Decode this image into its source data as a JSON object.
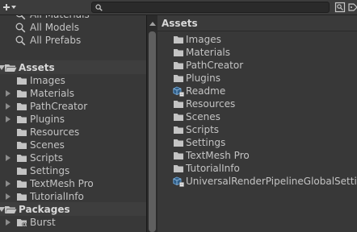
{
  "toolbar": {
    "add_icon": "plus-dropdown-icon",
    "search": {
      "icon": "search-icon",
      "value": ""
    }
  },
  "sidebar": {
    "favorites": [
      {
        "label": "All Materials",
        "icon": "search-icon"
      },
      {
        "label": "All Models",
        "icon": "search-icon"
      },
      {
        "label": "All Prefabs",
        "icon": "search-icon"
      }
    ],
    "assets_header": "Assets",
    "asset_folders": [
      {
        "label": "Images",
        "expandable": false
      },
      {
        "label": "Materials",
        "expandable": true
      },
      {
        "label": "PathCreator",
        "expandable": true
      },
      {
        "label": "Plugins",
        "expandable": true
      },
      {
        "label": "Resources",
        "expandable": false
      },
      {
        "label": "Scenes",
        "expandable": false
      },
      {
        "label": "Scripts",
        "expandable": true
      },
      {
        "label": "Settings",
        "expandable": false
      },
      {
        "label": "TextMesh Pro",
        "expandable": true
      },
      {
        "label": "TutorialInfo",
        "expandable": true
      }
    ],
    "packages_header": "Packages",
    "package_items": [
      {
        "label": "Burst",
        "expandable": true
      }
    ]
  },
  "content": {
    "title": "Assets",
    "items": [
      {
        "label": "Images",
        "type": "folder"
      },
      {
        "label": "Materials",
        "type": "folder"
      },
      {
        "label": "PathCreator",
        "type": "folder"
      },
      {
        "label": "Plugins",
        "type": "folder"
      },
      {
        "label": "Readme",
        "type": "asset"
      },
      {
        "label": "Resources",
        "type": "folder"
      },
      {
        "label": "Scenes",
        "type": "folder"
      },
      {
        "label": "Scripts",
        "type": "folder"
      },
      {
        "label": "Settings",
        "type": "folder"
      },
      {
        "label": "TextMesh Pro",
        "type": "folder"
      },
      {
        "label": "TutorialInfo",
        "type": "folder"
      },
      {
        "label": "UniversalRenderPipelineGlobalSettings",
        "type": "asset"
      }
    ]
  }
}
